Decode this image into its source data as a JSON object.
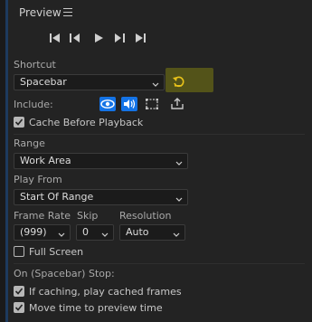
{
  "panel": {
    "title": "Preview"
  },
  "transport": {
    "buttons": [
      "first-frame",
      "previous-frame",
      "play",
      "next-frame",
      "last-frame"
    ]
  },
  "shortcut": {
    "label": "Shortcut",
    "value": "Spacebar",
    "reset_icon": "reset-arrow-icon"
  },
  "include": {
    "label": "Include:",
    "buttons": [
      {
        "icon": "eye-icon",
        "active": true
      },
      {
        "icon": "speaker-icon",
        "active": true
      },
      {
        "icon": "overlay-frame-icon",
        "active": false
      },
      {
        "icon": "export-icon",
        "active": false
      }
    ]
  },
  "cache_before_playback": {
    "label": "Cache Before Playback",
    "checked": true
  },
  "range": {
    "label": "Range",
    "value": "Work Area"
  },
  "play_from": {
    "label": "Play From",
    "value": "Start Of Range"
  },
  "frame_rate": {
    "label": "Frame Rate",
    "value": "(999)"
  },
  "skip": {
    "label": "Skip",
    "value": "0"
  },
  "resolution": {
    "label": "Resolution",
    "value": "Auto"
  },
  "full_screen": {
    "label": "Full Screen",
    "checked": false
  },
  "on_stop": {
    "label": "On (Spacebar) Stop:",
    "options": [
      {
        "label": "If caching, play cached frames",
        "checked": true
      },
      {
        "label": "Move time to preview time",
        "checked": true
      }
    ]
  },
  "colors": {
    "accent": "#1473e6",
    "highlight": "#7b7b12"
  }
}
